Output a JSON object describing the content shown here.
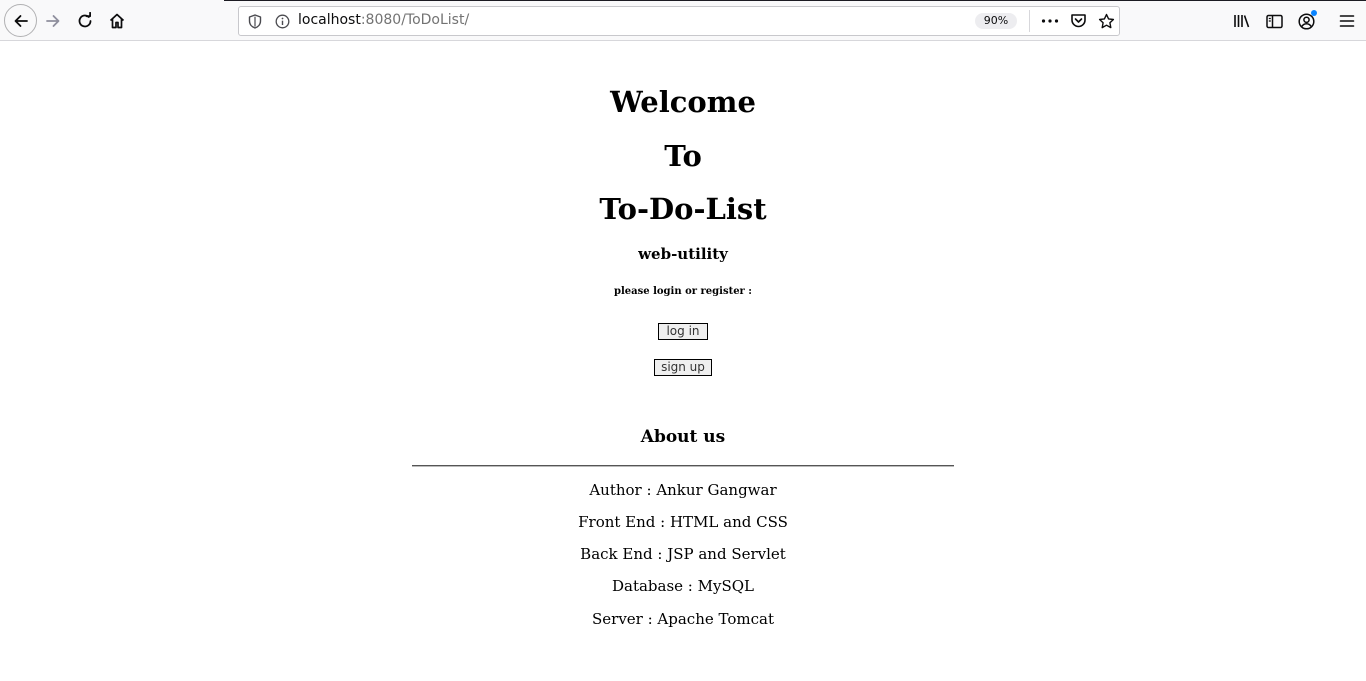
{
  "browser": {
    "url_host": "localhost",
    "url_rest": ":8080/ToDoList/",
    "zoom": "90%"
  },
  "page": {
    "heading_line1": "Welcome",
    "heading_line2": "To",
    "heading_line3": "To-Do-List",
    "subtitle": "web-utility",
    "prompt": "please login or register :",
    "login_label": "log in",
    "signup_label": "sign up",
    "about_title": "About us",
    "about_lines": [
      "Author : Ankur Gangwar",
      "Front End : HTML and CSS",
      "Back End : JSP and Servlet",
      "Database : MySQL",
      "Server : Apache Tomcat"
    ]
  },
  "icons": {
    "back": "arrow-left-icon",
    "forward": "arrow-right-icon",
    "reload": "reload-icon",
    "home": "home-icon",
    "shield": "shield-icon",
    "info": "info-icon",
    "more": "ellipsis-icon",
    "pocket": "pocket-icon",
    "bookmark": "star-icon",
    "library": "library-icon",
    "sidebar": "sidebar-icon",
    "account": "account-icon",
    "menu": "hamburger-menu-icon"
  },
  "colors": {
    "accent_dot": "#0a84ff",
    "chrome_bg": "#f9f9fa"
  }
}
